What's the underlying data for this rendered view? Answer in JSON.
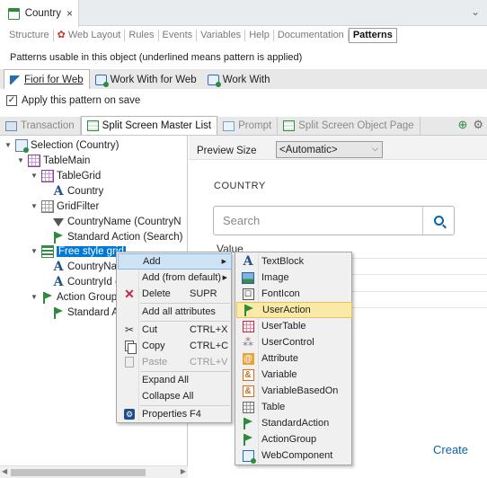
{
  "window": {
    "tab_title": "Country",
    "close_glyph": "×",
    "chevron_glyph": "⌄"
  },
  "part_tabs": [
    {
      "label": "Structure"
    },
    {
      "label": "Web Layout"
    },
    {
      "label": "Rules"
    },
    {
      "label": "Events"
    },
    {
      "label": "Variables"
    },
    {
      "label": "Help"
    },
    {
      "label": "Documentation"
    },
    {
      "label": "Patterns",
      "active": true
    }
  ],
  "patterns_info": "Patterns usable in this object (underlined means pattern is applied)",
  "pattern_tabs": [
    {
      "label": "Fiori for Web",
      "active": true
    },
    {
      "label": "Work With for Web"
    },
    {
      "label": "Work With"
    }
  ],
  "apply_pattern": {
    "label": "Apply this pattern on save",
    "checked": true,
    "check_glyph": "✓"
  },
  "instance_tabs": [
    {
      "label": "Transaction"
    },
    {
      "label": "Split Screen Master List",
      "active": true
    },
    {
      "label": "Prompt"
    },
    {
      "label": "Split Screen Object Page"
    }
  ],
  "toolbar_glyphs": {
    "add_instance": "⊕",
    "settings": "⚙"
  },
  "tree": [
    {
      "label": "Selection (Country)",
      "icon": "selection-icon",
      "twisty": "▼"
    },
    {
      "label": "TableMain",
      "icon": "table-icon",
      "twisty": "▼"
    },
    {
      "label": "TableGrid",
      "icon": "table-icon",
      "twisty": "▼"
    },
    {
      "label": "Country",
      "icon": "attribute-icon",
      "twisty": ""
    },
    {
      "label": "GridFilter",
      "icon": "grid-icon",
      "twisty": "▼"
    },
    {
      "label": "CountryName (CountryN",
      "icon": "filter-icon",
      "twisty": ""
    },
    {
      "label": "Standard Action (Search)",
      "icon": "flag-icon",
      "twisty": ""
    },
    {
      "label": "Free style grid",
      "icon": "freestyle-grid-icon",
      "twisty": "▼",
      "selected": true
    },
    {
      "label": "CountryNar",
      "icon": "attribute-icon",
      "twisty": ""
    },
    {
      "label": "CountryId (",
      "icon": "attribute-icon",
      "twisty": ""
    },
    {
      "label": "Action Group",
      "icon": "flag-icon",
      "twisty": "▼"
    },
    {
      "label": "Standard A",
      "icon": "flag-icon",
      "twisty": ""
    }
  ],
  "tree_attr_glyph": "A",
  "preview": {
    "size_label": "Preview Size",
    "size_value": "<Automatic>",
    "dropdown_glyph": "⌵",
    "heading": "COUNTRY",
    "search_placeholder": "Search",
    "value_label": "Value",
    "create_link": "Create"
  },
  "scroll_glyphs": {
    "left": "◀",
    "right": "▶"
  },
  "context_menu": {
    "add": "Add",
    "add_from_default": "Add (from default)",
    "delete": "Delete",
    "delete_shortcut": "SUPR",
    "add_all_attributes": "Add all attributes",
    "cut": "Cut",
    "cut_shortcut": "CTRL+X",
    "copy": "Copy",
    "copy_shortcut": "CTRL+C",
    "paste": "Paste",
    "paste_shortcut": "CTRL+V",
    "expand_all": "Expand All",
    "collapse_all": "Collapse All",
    "properties": "Properties",
    "properties_shortcut": "F4",
    "submenu_arrow": "▶",
    "delete_glyph": "✕",
    "cut_glyph": "✂",
    "properties_glyph": "⚙"
  },
  "submenu": [
    {
      "label": "TextBlock",
      "icon": "textblock-icon"
    },
    {
      "label": "Image",
      "icon": "image-icon"
    },
    {
      "label": "FontIcon",
      "icon": "fonticon-icon"
    },
    {
      "label": "UserAction",
      "icon": "flag-icon",
      "highlighted": true
    },
    {
      "label": "UserTable",
      "icon": "usertable-icon"
    },
    {
      "label": "UserControl",
      "icon": "usercontrol-icon"
    },
    {
      "label": "Attribute",
      "icon": "attribute-icon"
    },
    {
      "label": "Variable",
      "icon": "variable-icon"
    },
    {
      "label": "VariableBasedOn",
      "icon": "variable-icon"
    },
    {
      "label": "Table",
      "icon": "table-icon"
    },
    {
      "label": "StandardAction",
      "icon": "flag-icon"
    },
    {
      "label": "ActionGroup",
      "icon": "flag-icon"
    },
    {
      "label": "WebComponent",
      "icon": "webcomponent-icon"
    }
  ],
  "submenu_glyphs": {
    "textblock": "A",
    "fonticon": "☐",
    "usercontrol": "⁂",
    "attribute": "@",
    "variable": "&"
  }
}
